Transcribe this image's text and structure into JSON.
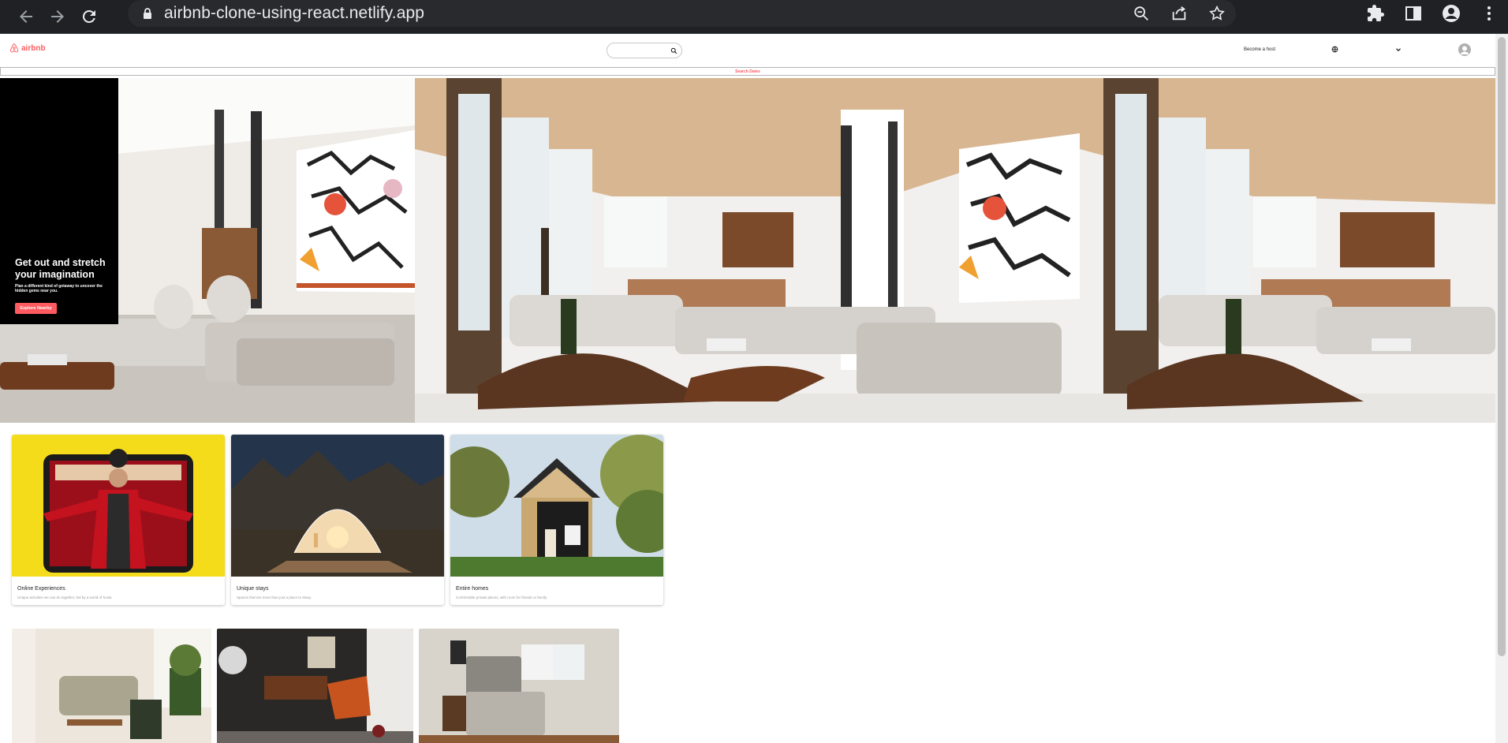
{
  "browser": {
    "url": "airbnb-clone-using-react.netlify.app"
  },
  "header": {
    "logo_text": "airbnb",
    "search_placeholder": "",
    "become_host": "Become a host"
  },
  "dates_bar": {
    "label": "Search Dates"
  },
  "hero": {
    "title": "Get out and stretch your imagination",
    "subtitle": "Plan a different kind of getaway to uncover the hidden gems near you.",
    "button_label": "Explore Nearby"
  },
  "cards": [
    {
      "title": "Online Experiences",
      "description": "Unique activities we can do together, led by a world of hosts."
    },
    {
      "title": "Unique stays",
      "description": "Spaces that are more than just a place to sleep."
    },
    {
      "title": "Entire homes",
      "description": "Comfortable private places, with room for friends or family."
    }
  ],
  "colors": {
    "brand": "#ff5a5f",
    "chrome_bg": "#202124",
    "omnibox_bg": "#282a2d"
  }
}
